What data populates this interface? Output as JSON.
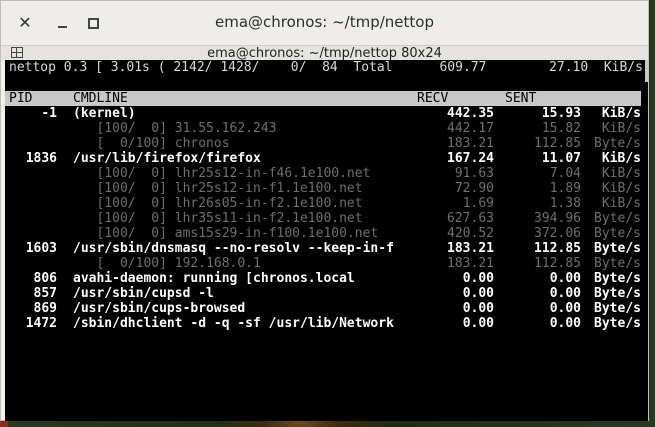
{
  "window": {
    "title": "ema@chronos: ~/tmp/nettop",
    "subtitle": "ema@chronos: ~/tmp/nettop 80x24",
    "close_glyph": "✕"
  },
  "status_line": "nettop 0.3 [ 3.01s ( 2142/ 1428/    0/  84  Total      609.77        27.10  KiB/s",
  "headers": {
    "pid": "PID",
    "cmdline": "CMDLINE",
    "recv": "RECV",
    "sent": "SENT"
  },
  "processes": [
    {
      "pid": "-1",
      "cmd": "(kernel)",
      "recv": "442.35",
      "sent": "15.93",
      "unit": "KiB/s",
      "style": "bold"
    },
    {
      "pid": "",
      "cmd": "   [100/  0] 31.55.162.243",
      "recv": "442.17",
      "sent": "15.82",
      "unit": "KiB/s",
      "style": "dim"
    },
    {
      "pid": "",
      "cmd": "   [  0/100] chronos",
      "recv": "183.21",
      "sent": "112.85",
      "unit": "Byte/s",
      "style": "dim"
    },
    {
      "pid": "1836",
      "cmd": "/usr/lib/firefox/firefox",
      "recv": "167.24",
      "sent": "11.07",
      "unit": "KiB/s",
      "style": "bold"
    },
    {
      "pid": "",
      "cmd": "   [100/  0] lhr25s12-in-f46.1e100.net",
      "recv": "91.63",
      "sent": "7.04",
      "unit": "KiB/s",
      "style": "dim"
    },
    {
      "pid": "",
      "cmd": "   [100/  0] lhr25s12-in-f1.1e100.net",
      "recv": "72.90",
      "sent": "1.89",
      "unit": "KiB/s",
      "style": "dim"
    },
    {
      "pid": "",
      "cmd": "   [100/  0] lhr26s05-in-f2.1e100.net",
      "recv": "1.69",
      "sent": "1.38",
      "unit": "KiB/s",
      "style": "dim"
    },
    {
      "pid": "",
      "cmd": "   [100/  0] lhr35s11-in-f2.1e100.net",
      "recv": "627.63",
      "sent": "394.96",
      "unit": "Byte/s",
      "style": "dim"
    },
    {
      "pid": "",
      "cmd": "   [100/  0] ams15s29-in-f100.1e100.net",
      "recv": "420.52",
      "sent": "372.06",
      "unit": "Byte/s",
      "style": "dim"
    },
    {
      "pid": "1603",
      "cmd": "/usr/sbin/dnsmasq --no-resolv --keep-in-f",
      "recv": "183.21",
      "sent": "112.85",
      "unit": "Byte/s",
      "style": "bold"
    },
    {
      "pid": "",
      "cmd": "   [  0/100] 192.168.0.1",
      "recv": "183.21",
      "sent": "112.85",
      "unit": "Byte/s",
      "style": "dim"
    },
    {
      "pid": "806",
      "cmd": "avahi-daemon: running [chronos.local",
      "recv": "0.00",
      "sent": "0.00",
      "unit": "Byte/s",
      "style": "bold"
    },
    {
      "pid": "857",
      "cmd": "/usr/sbin/cupsd -l",
      "recv": "0.00",
      "sent": "0.00",
      "unit": "Byte/s",
      "style": "bold"
    },
    {
      "pid": "869",
      "cmd": "/usr/sbin/cups-browsed",
      "recv": "0.00",
      "sent": "0.00",
      "unit": "Byte/s",
      "style": "bold"
    },
    {
      "pid": "1472",
      "cmd": "/sbin/dhclient -d -q -sf /usr/lib/Network",
      "recv": "0.00",
      "sent": "0.00",
      "unit": "Byte/s",
      "style": "bold"
    }
  ]
}
